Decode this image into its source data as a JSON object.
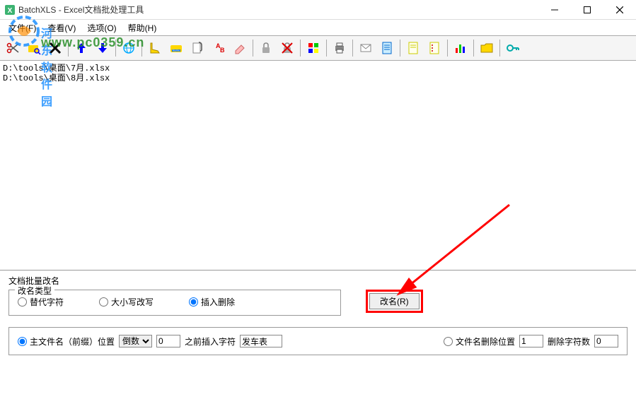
{
  "title": "BatchXLS - Excel文档批处理工具",
  "menu": {
    "file": "文件(F)",
    "view": "查看(V)",
    "options": "选项(O)",
    "help": "帮助(H)"
  },
  "watermark": {
    "site": "河东软件园",
    "url": "www.pc0359.cn"
  },
  "files": [
    "D:\\tools\\桌面\\7月.xlsx",
    "D:\\tools\\桌面\\8月.xlsx"
  ],
  "panel": {
    "title": "文档批量改名",
    "group_title": "改名类型",
    "radio_replace": "替代字符",
    "radio_case": "大小写改写",
    "radio_insert": "插入删除",
    "rename_btn": "改名(R)",
    "opt_main_prefix": "主文件名（前缀）位置",
    "opt_reverse": "倒数",
    "opt_pos_value": "0",
    "opt_insert_before": "之前插入字符",
    "opt_insert_text": "发车表",
    "opt_delete_pos": "文件名删除位置",
    "opt_delete_pos_value": "1",
    "opt_delete_count": "删除字符数",
    "opt_delete_count_value": "0"
  }
}
